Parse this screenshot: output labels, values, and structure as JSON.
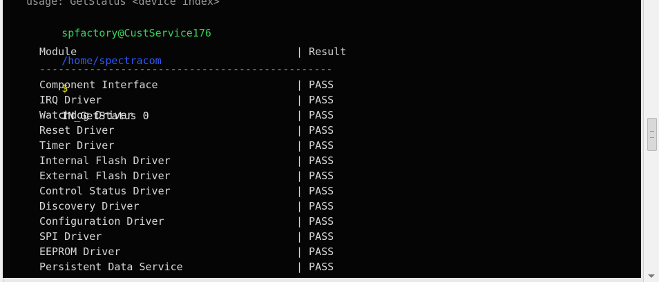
{
  "terminal": {
    "usage_line": "usage: GetStatus <device index>",
    "prompt_user": "spfactory@CustService176",
    "prompt_path": "/home/spectracom",
    "prompt_symbol": "$",
    "command": "IN_GetStatus 0",
    "table": {
      "header_module": "Module",
      "header_result": "| Result",
      "separator": "-----------------------------------------------",
      "rows": [
        {
          "module": "Component Interface",
          "result": "| PASS"
        },
        {
          "module": "IRQ Driver",
          "result": "| PASS"
        },
        {
          "module": "Watchdog Driver",
          "result": "| PASS"
        },
        {
          "module": "Reset Driver",
          "result": "| PASS"
        },
        {
          "module": "Timer Driver",
          "result": "| PASS"
        },
        {
          "module": "Internal Flash Driver",
          "result": "| PASS"
        },
        {
          "module": "External Flash Driver",
          "result": "| PASS"
        },
        {
          "module": "Control Status Driver",
          "result": "| PASS"
        },
        {
          "module": "Discovery Driver",
          "result": "| PASS"
        },
        {
          "module": "Configuration Driver",
          "result": "| PASS"
        },
        {
          "module": "SPI Driver",
          "result": "| PASS"
        },
        {
          "module": "EEPROM Driver",
          "result": "| PASS"
        },
        {
          "module": "Persistent Data Service",
          "result": "| PASS"
        }
      ]
    }
  },
  "colors": {
    "background": "#050505",
    "prompt_user": "#36d25a",
    "prompt_path": "#2f58ff",
    "prompt_symbol": "#d8d800",
    "text": "#d7d7d7"
  },
  "icons": {
    "scroll_thumb": "scroll-thumb-icon",
    "scroll_down": "chevron-down-icon"
  }
}
